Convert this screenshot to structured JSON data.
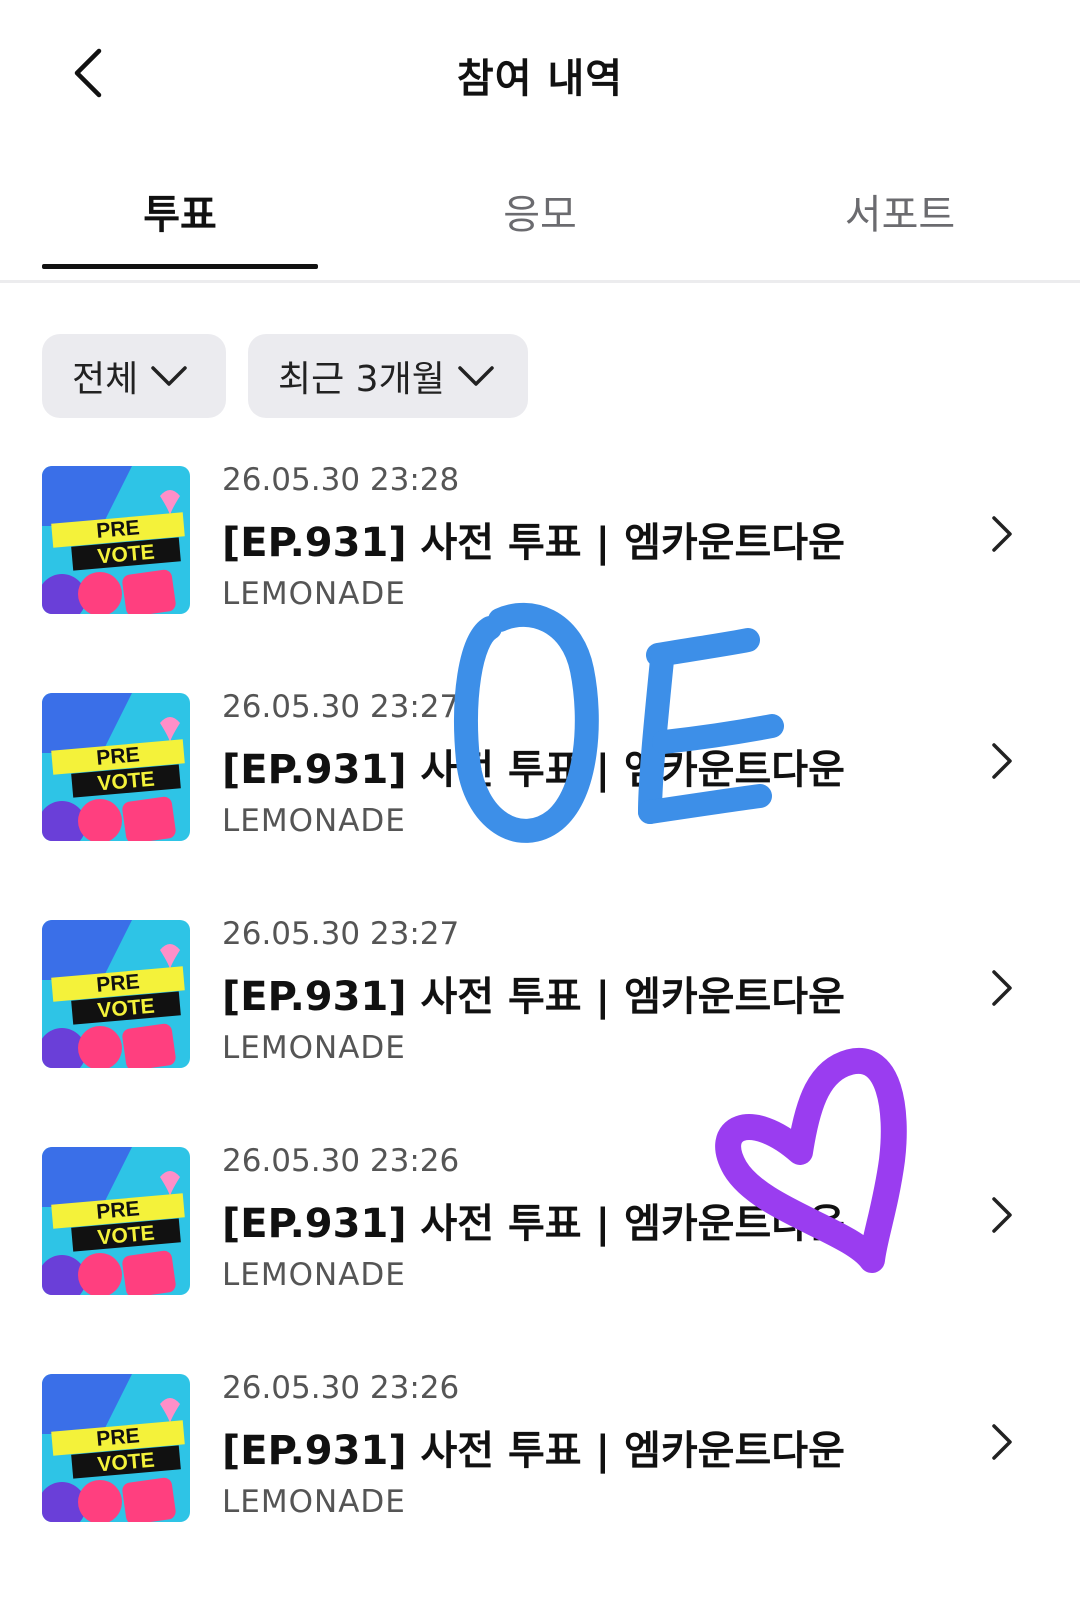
{
  "header": {
    "title": "참여 내역",
    "back_icon": "chevron-left-icon"
  },
  "tabs": [
    {
      "label": "투표",
      "active": true
    },
    {
      "label": "응모",
      "active": false
    },
    {
      "label": "서포트",
      "active": false
    }
  ],
  "filters": [
    {
      "label": "전체"
    },
    {
      "label": "최근 3개월"
    }
  ],
  "thumbnail": {
    "line1": "PRE",
    "line2": "VOTE"
  },
  "items": [
    {
      "date": "26.05.30 23:28",
      "title": "[EP.931] 사전 투표 | 엠카운트다운",
      "brand": "LEMONADE"
    },
    {
      "date": "26.05.30 23:27",
      "title": "[EP.931] 사전 투표 | 엠카운트다운",
      "brand": "LEMONADE"
    },
    {
      "date": "26.05.30 23:27",
      "title": "[EP.931] 사전 투표 | 엠카운트다운",
      "brand": "LEMONADE"
    },
    {
      "date": "26.05.30 23:26",
      "title": "[EP.931] 사전 투표 | 엠카운트다운",
      "brand": "LEMONADE"
    },
    {
      "date": "26.05.30 23:26",
      "title": "[EP.931] 사전 투표 | 엠카운트다운",
      "brand": "LEMONADE"
    }
  ],
  "colors": {
    "scribble_blue": "#3d8fe8",
    "scribble_purple": "#9a3df0",
    "thumb_bg": "#2ec4e6",
    "thumb_banner": "#f4f23a"
  }
}
